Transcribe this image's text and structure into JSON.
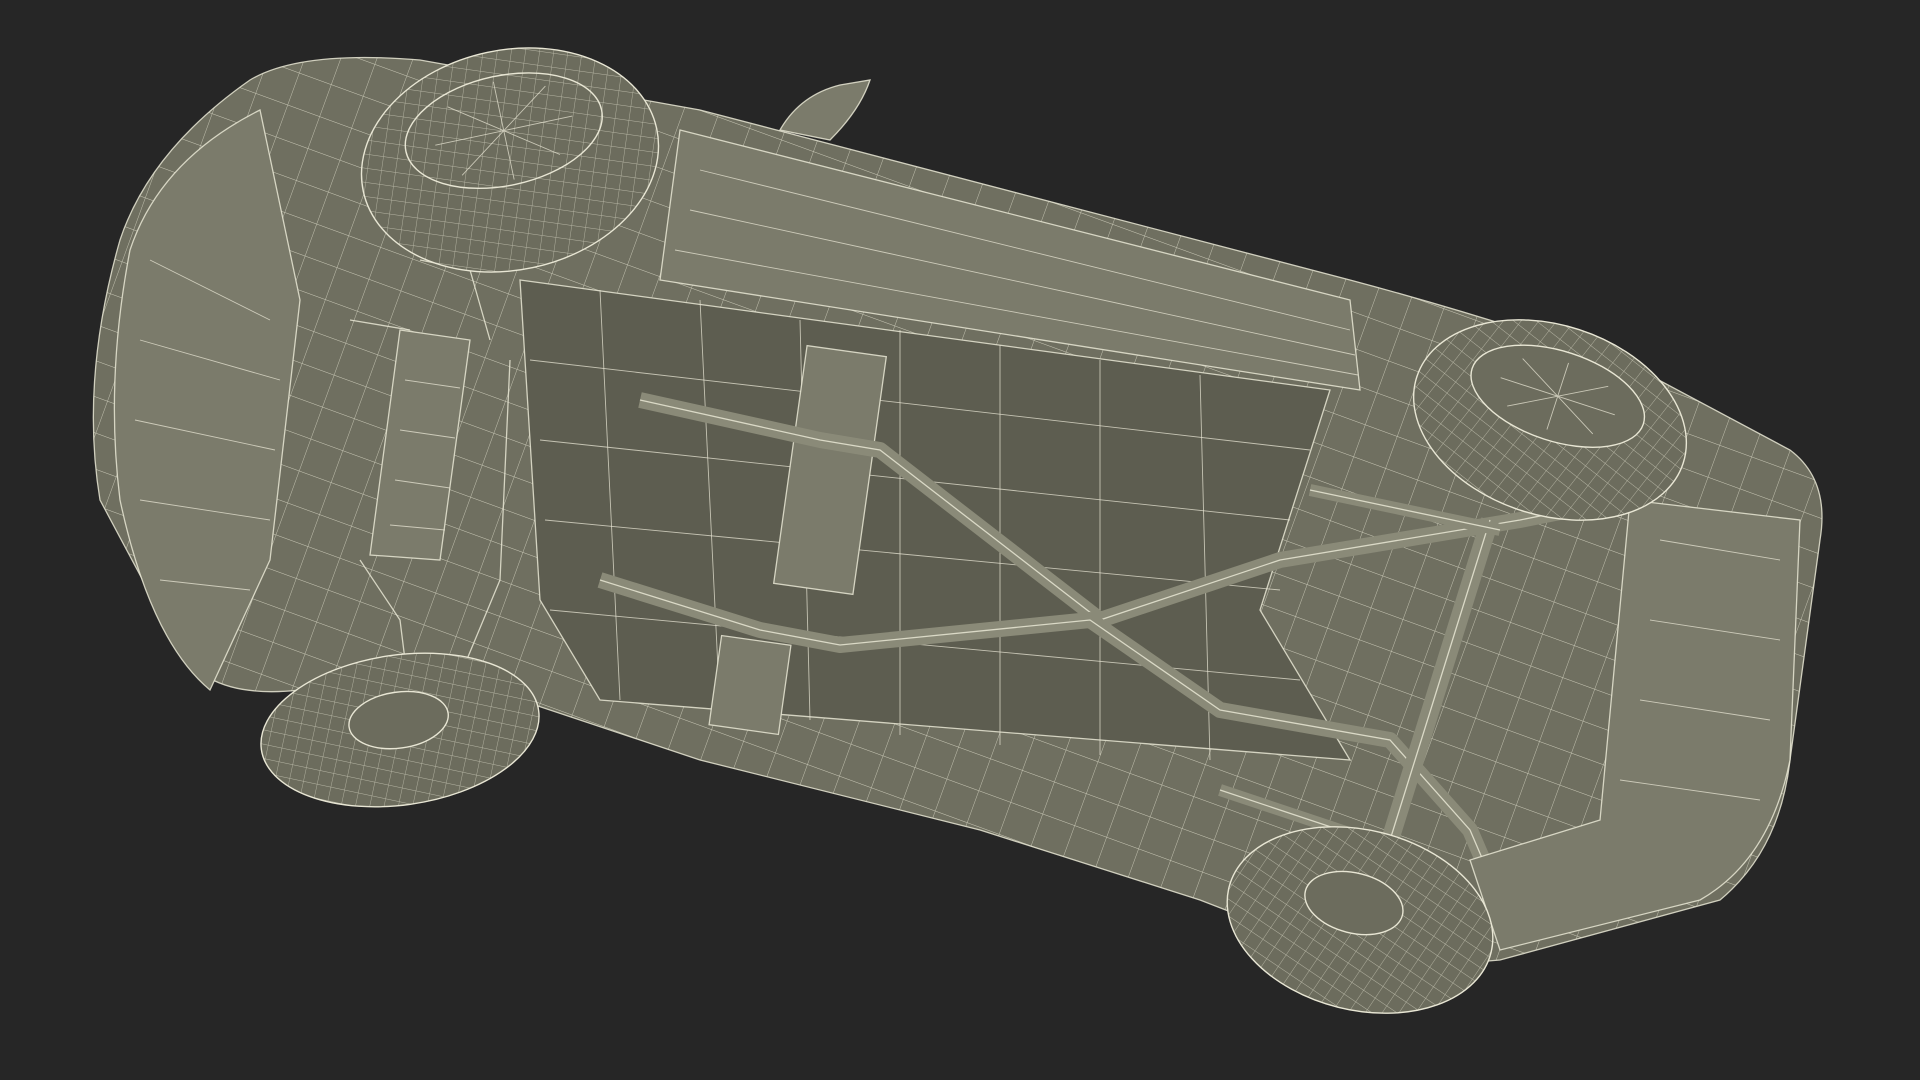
{
  "scene": {
    "background_color": "#262626",
    "model_fill_color": "#6f6f60",
    "wire_color": "#e8e6d4",
    "subject": "car-underside-wireframe"
  }
}
